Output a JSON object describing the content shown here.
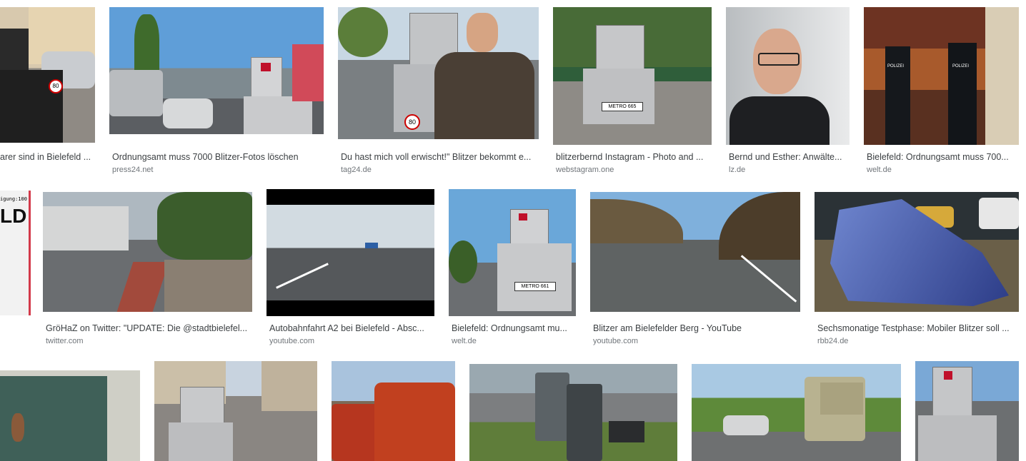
{
  "results": [
    {
      "caption": "arer sind in Bielefeld ...",
      "source": ""
    },
    {
      "caption": "Ordnungsamt muss 7000 Blitzer-Fotos löschen",
      "source": "press24.net"
    },
    {
      "caption": "Du hast mich voll erwischt!\" Blitzer bekommt e...",
      "source": "tag24.de"
    },
    {
      "caption": "blitzerbernd Instagram - Photo and ...",
      "source": "webstagram.one"
    },
    {
      "caption": "Bernd und Esther: Anwälte...",
      "source": "lz.de"
    },
    {
      "caption": "Bielefeld: Ordnungsamt muss 700...",
      "source": "welt.de"
    },
    {
      "caption": "GröHaZ on Twitter: \"UPDATE: Die @stadtbielefel...",
      "source": "twitter.com"
    },
    {
      "caption": "Autobahnfahrt A2 bei Bielefeld - Absc...",
      "source": "youtube.com"
    },
    {
      "caption": "Bielefeld: Ordnungsamt mu...",
      "source": "welt.de"
    },
    {
      "caption": "Blitzer am Bielefelder Berg - YouTube",
      "source": "youtube.com"
    },
    {
      "caption": "Sechsmonatige Testphase: Mobiler Blitzer soll ...",
      "source": "rbb24.de"
    }
  ],
  "overlay_texts": {
    "plate_1": "80",
    "plate_3": "80",
    "plate_4": "METRO 665",
    "plate_9": "METRO 661",
    "sign_7_text": "igung:100",
    "sign_7_big": "LD",
    "police_1": "POLIZEI",
    "police_2": "POLIZEI"
  }
}
